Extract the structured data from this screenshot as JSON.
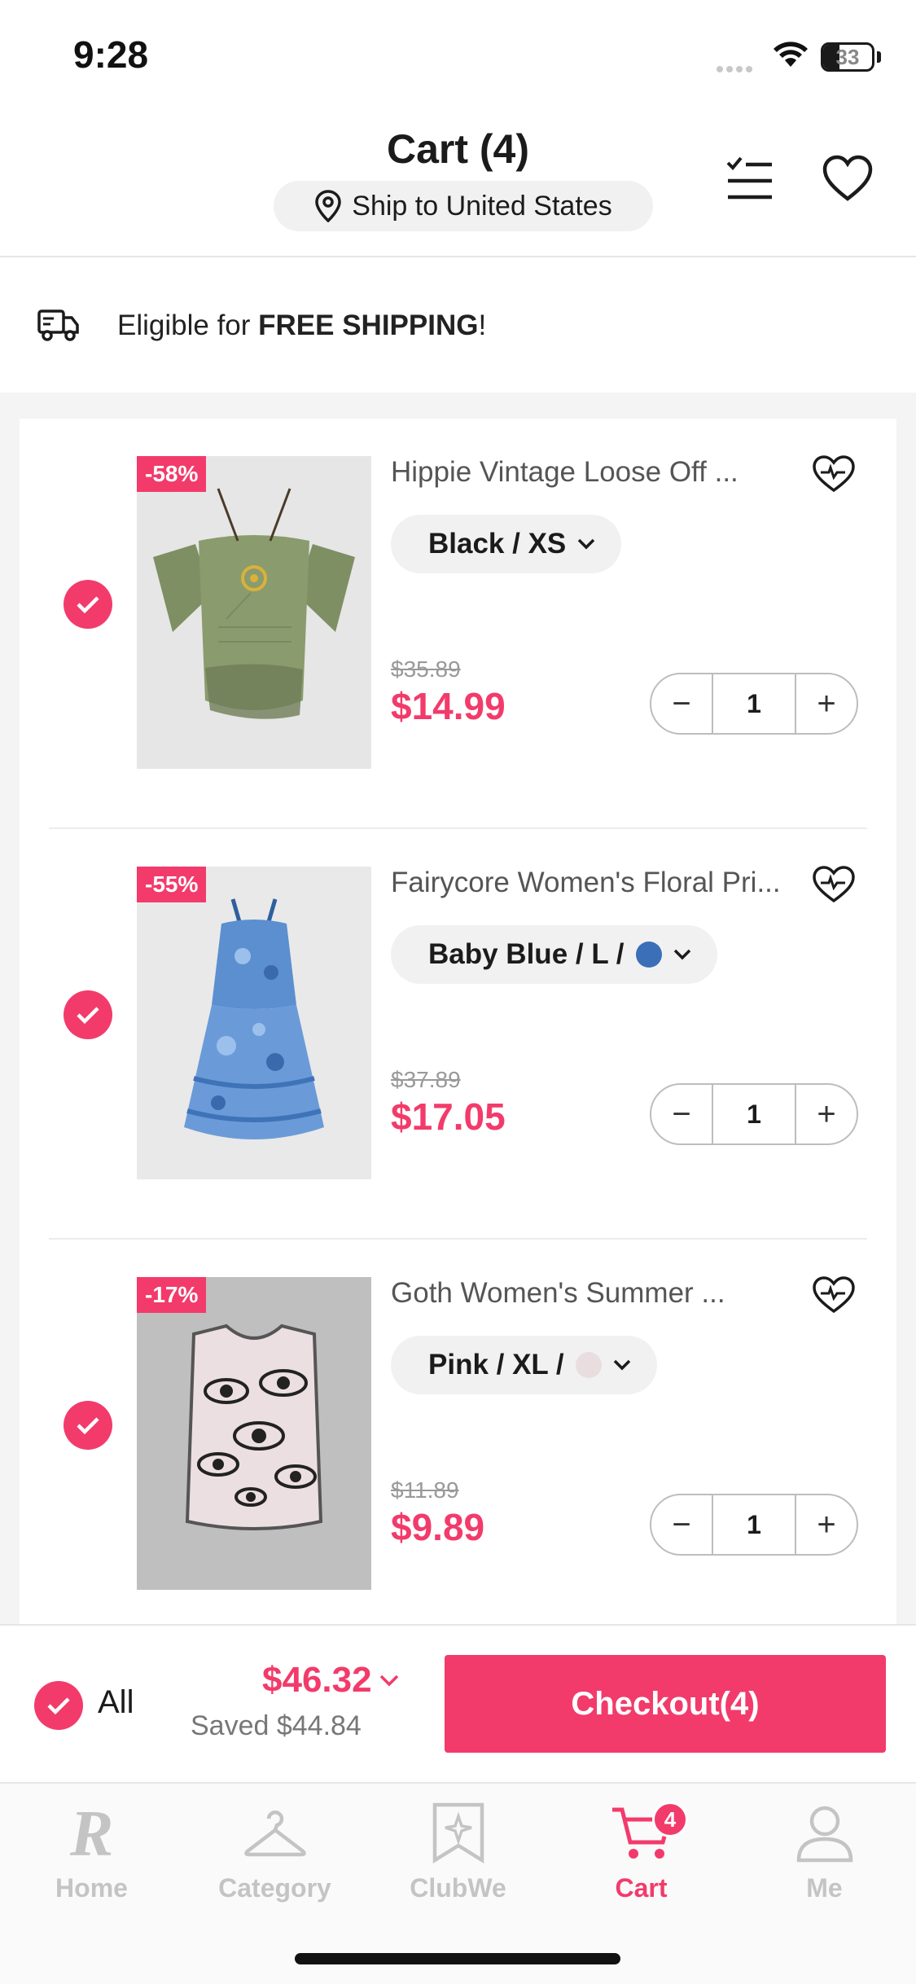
{
  "status_bar": {
    "time": "9:28",
    "battery": "33",
    "battery_level": 0.33
  },
  "header": {
    "title": "Cart (4)",
    "ship_to": "Ship to United States"
  },
  "shipping_banner": {
    "prefix": "Eligible for ",
    "bold": "FREE SHIPPING",
    "suffix": "!"
  },
  "items": [
    {
      "discount": "-58%",
      "name": "Hippie Vintage Loose Off ...",
      "variant": "Black / XS",
      "swatch_color": "",
      "original_price": "$35.89",
      "price": "$14.99",
      "quantity": "1",
      "minus": "−",
      "plus": "+"
    },
    {
      "discount": "-55%",
      "name": "Fairycore Women's Floral Pri...",
      "variant": "Baby Blue / L  /",
      "swatch_color": "#3b6fb8",
      "original_price": "$37.89",
      "price": "$17.05",
      "quantity": "1",
      "minus": "−",
      "plus": "+"
    },
    {
      "discount": "-17%",
      "name": "Goth Women's Summer ...",
      "variant": "Pink / XL  /",
      "swatch_color": "#e9dde0",
      "original_price": "$11.89",
      "price": "$9.89",
      "quantity": "1",
      "minus": "−",
      "plus": "+"
    }
  ],
  "checkout": {
    "all_label": "All",
    "total": "$46.32",
    "saved": "Saved $44.84",
    "button": "Checkout(4)"
  },
  "tabbar": {
    "tabs": [
      {
        "label": "Home",
        "icon": "brand-r-icon"
      },
      {
        "label": "Category",
        "icon": "hanger-icon"
      },
      {
        "label": "ClubWe",
        "icon": "bookmark-star-icon"
      },
      {
        "label": "Cart",
        "icon": "cart-icon",
        "badge": "4"
      },
      {
        "label": "Me",
        "icon": "person-icon"
      }
    ]
  },
  "colors": {
    "accent": "#f23b6b",
    "muted": "#c4c4c4"
  }
}
